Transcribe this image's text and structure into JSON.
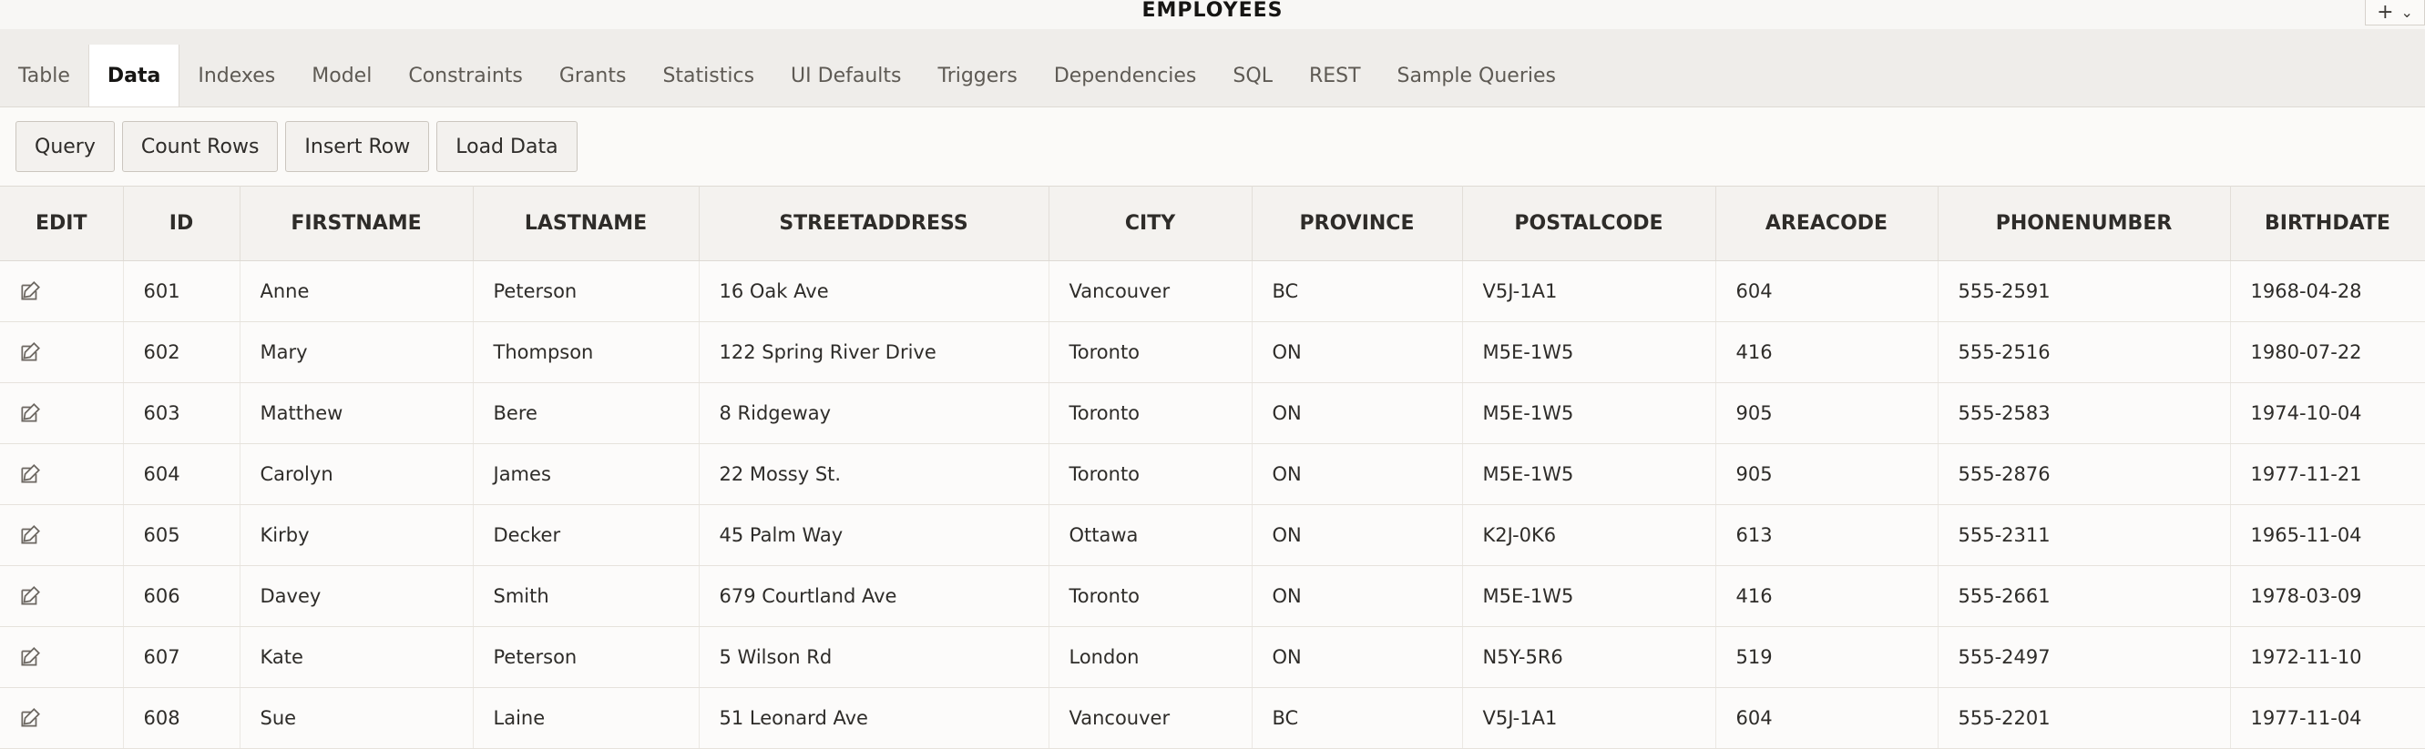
{
  "window": {
    "title": "EMPLOYEES",
    "add_label": "+"
  },
  "tabs": [
    {
      "label": "Table"
    },
    {
      "label": "Data"
    },
    {
      "label": "Indexes"
    },
    {
      "label": "Model"
    },
    {
      "label": "Constraints"
    },
    {
      "label": "Grants"
    },
    {
      "label": "Statistics"
    },
    {
      "label": "UI Defaults"
    },
    {
      "label": "Triggers"
    },
    {
      "label": "Dependencies"
    },
    {
      "label": "SQL"
    },
    {
      "label": "REST"
    },
    {
      "label": "Sample Queries"
    }
  ],
  "active_tab": "Data",
  "toolbar": {
    "query_label": "Query",
    "count_rows_label": "Count Rows",
    "insert_row_label": "Insert Row",
    "load_data_label": "Load Data"
  },
  "table": {
    "columns": [
      "EDIT",
      "ID",
      "FIRSTNAME",
      "LASTNAME",
      "STREETADDRESS",
      "CITY",
      "PROVINCE",
      "POSTALCODE",
      "AREACODE",
      "PHONENUMBER",
      "BIRTHDATE"
    ],
    "rows": [
      [
        "601",
        "Anne",
        "Peterson",
        "16 Oak Ave",
        "Vancouver",
        "BC",
        "V5J-1A1",
        "604",
        "555-2591",
        "1968-04-28"
      ],
      [
        "602",
        "Mary",
        "Thompson",
        "122 Spring River Drive",
        "Toronto",
        "ON",
        "M5E-1W5",
        "416",
        "555-2516",
        "1980-07-22"
      ],
      [
        "603",
        "Matthew",
        "Bere",
        "8 Ridgeway",
        "Toronto",
        "ON",
        "M5E-1W5",
        "905",
        "555-2583",
        "1974-10-04"
      ],
      [
        "604",
        "Carolyn",
        "James",
        "22 Mossy St.",
        "Toronto",
        "ON",
        "M5E-1W5",
        "905",
        "555-2876",
        "1977-11-21"
      ],
      [
        "605",
        "Kirby",
        "Decker",
        "45 Palm Way",
        "Ottawa",
        "ON",
        "K2J-0K6",
        "613",
        "555-2311",
        "1965-11-04"
      ],
      [
        "606",
        "Davey",
        "Smith",
        "679 Courtland Ave",
        "Toronto",
        "ON",
        "M5E-1W5",
        "416",
        "555-2661",
        "1978-03-09"
      ],
      [
        "607",
        "Kate",
        "Peterson",
        "5 Wilson Rd",
        "London",
        "ON",
        "N5Y-5R6",
        "519",
        "555-2497",
        "1972-11-10"
      ],
      [
        "608",
        "Sue",
        "Laine",
        "51 Leonard Ave",
        "Vancouver",
        "BC",
        "V5J-1A1",
        "604",
        "555-2201",
        "1977-11-04"
      ]
    ]
  },
  "icons": {
    "edit": "edit-pencil-icon",
    "add": "plus-icon",
    "menu": "chevron-down-icon"
  }
}
